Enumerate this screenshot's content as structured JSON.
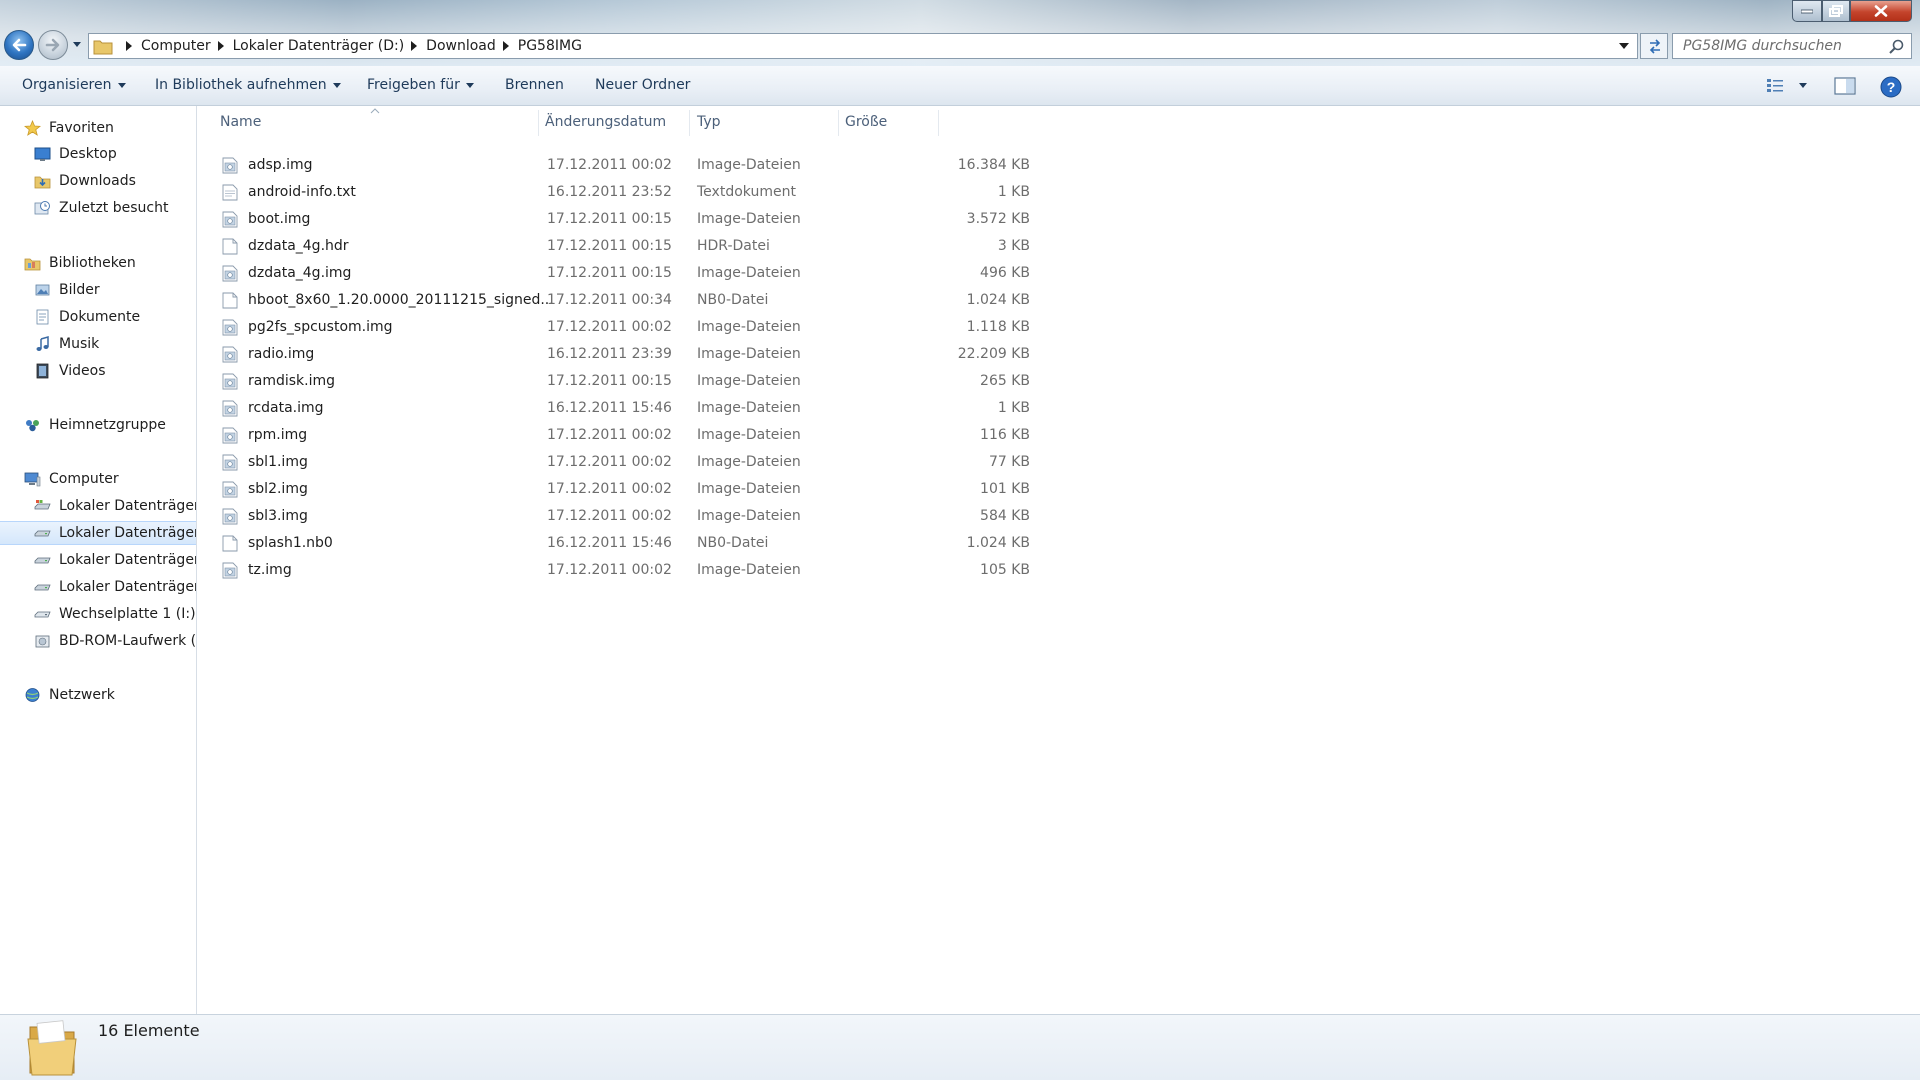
{
  "address": {
    "crumbs": [
      "Computer",
      "Lokaler Datenträger (D:)",
      "Download",
      "PG58IMG"
    ],
    "search_placeholder": "PG58IMG durchsuchen"
  },
  "toolbar": {
    "organize": "Organisieren",
    "library": "In Bibliothek aufnehmen",
    "share": "Freigeben für",
    "burn": "Brennen",
    "new_folder": "Neuer Ordner"
  },
  "nav": {
    "favorites": "Favoriten",
    "desktop": "Desktop",
    "downloads": "Downloads",
    "recent": "Zuletzt besucht",
    "libraries": "Bibliotheken",
    "pictures": "Bilder",
    "documents": "Dokumente",
    "music": "Musik",
    "videos": "Videos",
    "homegroup": "Heimnetzgruppe",
    "computer": "Computer",
    "drives": [
      "Lokaler Datenträger",
      "Lokaler Datenträger",
      "Lokaler Datenträger",
      "Lokaler Datenträger"
    ],
    "removable": "Wechselplatte 1 (I:)",
    "bdrom": "BD-ROM-Laufwerk (I",
    "network": "Netzwerk"
  },
  "columns": {
    "name": "Name",
    "date": "Änderungsdatum",
    "type": "Typ",
    "size": "Größe"
  },
  "files": [
    {
      "name": "adsp.img",
      "date": "17.12.2011 00:02",
      "type": "Image-Dateien",
      "size": "16.384 KB",
      "icon": "image-file-icon"
    },
    {
      "name": "android-info.txt",
      "date": "16.12.2011 23:52",
      "type": "Textdokument",
      "size": "1 KB",
      "icon": "text-file-icon"
    },
    {
      "name": "boot.img",
      "date": "17.12.2011 00:15",
      "type": "Image-Dateien",
      "size": "3.572 KB",
      "icon": "image-file-icon"
    },
    {
      "name": "dzdata_4g.hdr",
      "date": "17.12.2011 00:15",
      "type": "HDR-Datei",
      "size": "3 KB",
      "icon": "blank-file-icon"
    },
    {
      "name": "dzdata_4g.img",
      "date": "17.12.2011 00:15",
      "type": "Image-Dateien",
      "size": "496 KB",
      "icon": "image-file-icon"
    },
    {
      "name": "hboot_8x60_1.20.0000_20111215_signed...",
      "date": "17.12.2011 00:34",
      "type": "NB0-Datei",
      "size": "1.024 KB",
      "icon": "blank-file-icon"
    },
    {
      "name": "pg2fs_spcustom.img",
      "date": "17.12.2011 00:02",
      "type": "Image-Dateien",
      "size": "1.118 KB",
      "icon": "image-file-icon"
    },
    {
      "name": "radio.img",
      "date": "16.12.2011 23:39",
      "type": "Image-Dateien",
      "size": "22.209 KB",
      "icon": "image-file-icon"
    },
    {
      "name": "ramdisk.img",
      "date": "17.12.2011 00:15",
      "type": "Image-Dateien",
      "size": "265 KB",
      "icon": "image-file-icon"
    },
    {
      "name": "rcdata.img",
      "date": "16.12.2011 15:46",
      "type": "Image-Dateien",
      "size": "1 KB",
      "icon": "image-file-icon"
    },
    {
      "name": "rpm.img",
      "date": "17.12.2011 00:02",
      "type": "Image-Dateien",
      "size": "116 KB",
      "icon": "image-file-icon"
    },
    {
      "name": "sbl1.img",
      "date": "17.12.2011 00:02",
      "type": "Image-Dateien",
      "size": "77 KB",
      "icon": "image-file-icon"
    },
    {
      "name": "sbl2.img",
      "date": "17.12.2011 00:02",
      "type": "Image-Dateien",
      "size": "101 KB",
      "icon": "image-file-icon"
    },
    {
      "name": "sbl3.img",
      "date": "17.12.2011 00:02",
      "type": "Image-Dateien",
      "size": "584 KB",
      "icon": "image-file-icon"
    },
    {
      "name": "splash1.nb0",
      "date": "16.12.2011 15:46",
      "type": "NB0-Datei",
      "size": "1.024 KB",
      "icon": "blank-file-icon"
    },
    {
      "name": "tz.img",
      "date": "17.12.2011 00:02",
      "type": "Image-Dateien",
      "size": "105 KB",
      "icon": "image-file-icon"
    }
  ],
  "status": {
    "count": "16 Elemente"
  },
  "colors": {
    "selection": "#d5e7fb",
    "header_text": "#4c607a",
    "meta_text": "#6d6d6d",
    "close_button": "#c4442c"
  }
}
